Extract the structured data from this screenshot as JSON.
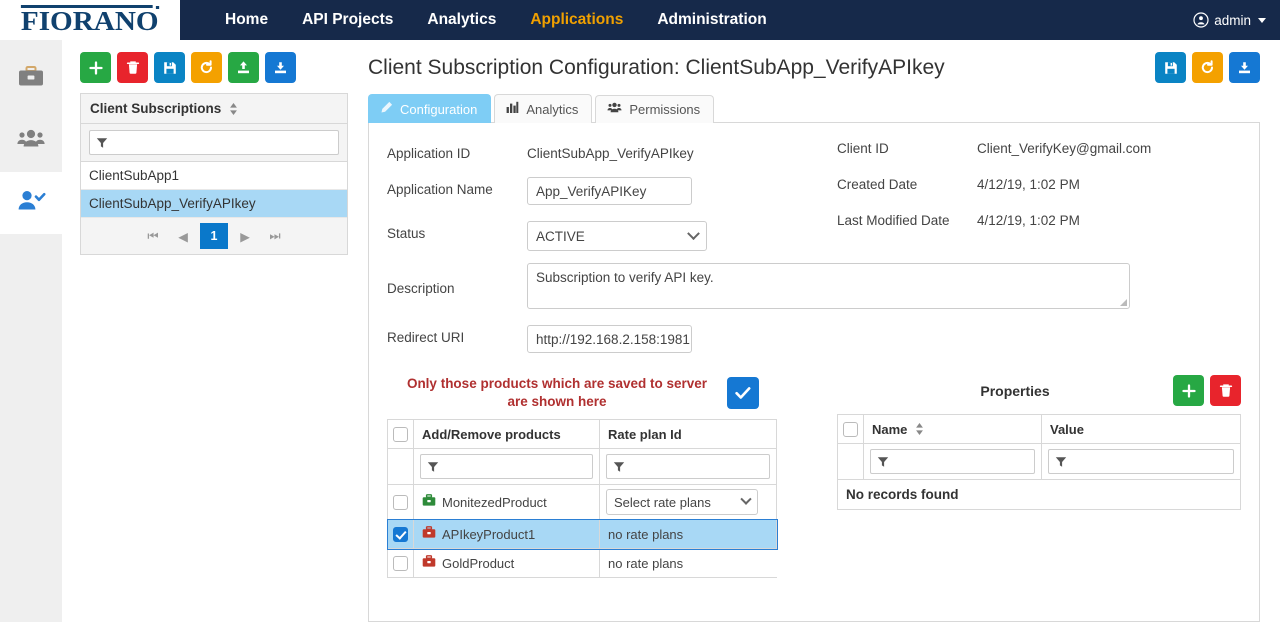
{
  "topnav": {
    "brand": "FIORANO",
    "items": [
      {
        "label": "Home",
        "active": false
      },
      {
        "label": "API Projects",
        "active": false
      },
      {
        "label": "Analytics",
        "active": false
      },
      {
        "label": "Applications",
        "active": true
      },
      {
        "label": "Administration",
        "active": false
      }
    ],
    "user": "admin",
    "accent_active": "#f0a000",
    "bar_color": "#16294a"
  },
  "rail": {
    "items": [
      {
        "icon": "briefcase-icon",
        "active": false
      },
      {
        "icon": "users-group-icon",
        "active": false
      },
      {
        "icon": "user-check-icon",
        "active": true
      }
    ]
  },
  "left_panel": {
    "toolbar": [
      {
        "icon": "plus-icon",
        "name": "add-subscription-button",
        "color": "#27a844"
      },
      {
        "icon": "trash-icon",
        "name": "delete-subscription-button",
        "color": "#e8242c"
      },
      {
        "icon": "save-icon",
        "name": "save-subscription-button",
        "color": "#0a84c4"
      },
      {
        "icon": "refresh-icon",
        "name": "refresh-subscription-button",
        "color": "#f4a100"
      },
      {
        "icon": "upload-icon",
        "name": "upload-subscription-button",
        "color": "#27a844"
      },
      {
        "icon": "download-icon",
        "name": "download-subscription-button",
        "color": "#1578d3"
      }
    ],
    "grid_title": "Client Subscriptions",
    "filter_value": "",
    "rows": [
      {
        "label": "ClientSubApp1",
        "selected": false
      },
      {
        "label": "ClientSubApp_VerifyAPIkey",
        "selected": true
      }
    ],
    "pager": {
      "first": "⏮",
      "prev": "◀",
      "page": "1",
      "next": "▶",
      "last": "⏭"
    }
  },
  "main": {
    "title": "Client Subscription Configuration: ClientSubApp_VerifyAPIkey",
    "toolbar": [
      {
        "icon": "save-icon",
        "name": "save-config-button",
        "color": "#0a84c4"
      },
      {
        "icon": "refresh-icon",
        "name": "refresh-config-button",
        "color": "#f4a100"
      },
      {
        "icon": "download-icon",
        "name": "download-config-button",
        "color": "#1578d3"
      }
    ],
    "tabs": [
      {
        "label": "Configuration",
        "icon": "pencil-icon",
        "active": true
      },
      {
        "label": "Analytics",
        "icon": "bar-chart-icon",
        "active": false
      },
      {
        "label": "Permissions",
        "icon": "users-group-icon",
        "active": false
      }
    ],
    "form": {
      "application_id_label": "Application ID",
      "application_id_value": "ClientSubApp_VerifyAPIkey",
      "application_name_label": "Application Name",
      "application_name_value": "App_VerifyAPIKey",
      "status_label": "Status",
      "status_value": "ACTIVE",
      "description_label": "Description",
      "description_value": "Subscription to verify API key.",
      "redirect_uri_label": "Redirect URI",
      "redirect_uri_value": "http://192.168.2.158:1981",
      "client_id_label": "Client ID",
      "client_id_value": "Client_VerifyKey@gmail.com",
      "created_date_label": "Created Date",
      "created_date_value": "4/12/19, 1:02 PM",
      "last_modified_label": "Last Modified Date",
      "last_modified_value": "4/12/19, 1:02 PM"
    },
    "products": {
      "warning": "Only those products which are saved to server are shown here",
      "confirm_icon": "check-icon",
      "columns": [
        "Add/Remove products",
        "Rate plan Id"
      ],
      "filter_products": "",
      "filter_rateplan": "",
      "rows": [
        {
          "name": "MonitezedProduct",
          "icon": "product-briefcase-icon",
          "icon_color": "#2e8b3a",
          "checked": false,
          "selected": false,
          "rate_plan": "Select rate plans",
          "rate_plan_is_select": true
        },
        {
          "name": "APIkeyProduct1",
          "icon": "product-briefcase-icon",
          "icon_color": "#c0392b",
          "checked": true,
          "selected": true,
          "rate_plan": "no rate plans",
          "rate_plan_is_select": false
        },
        {
          "name": "GoldProduct",
          "icon": "product-briefcase-icon",
          "icon_color": "#c0392b",
          "checked": false,
          "selected": false,
          "rate_plan": "no rate plans",
          "rate_plan_is_select": false
        }
      ]
    },
    "properties": {
      "title": "Properties",
      "toolbar": [
        {
          "icon": "plus-icon",
          "name": "add-property-button",
          "color": "#27a844"
        },
        {
          "icon": "trash-icon",
          "name": "delete-property-button",
          "color": "#e8242c"
        }
      ],
      "columns": [
        "Name",
        "Value"
      ],
      "filter_name": "",
      "filter_value": "",
      "empty_text": "No records found"
    }
  }
}
